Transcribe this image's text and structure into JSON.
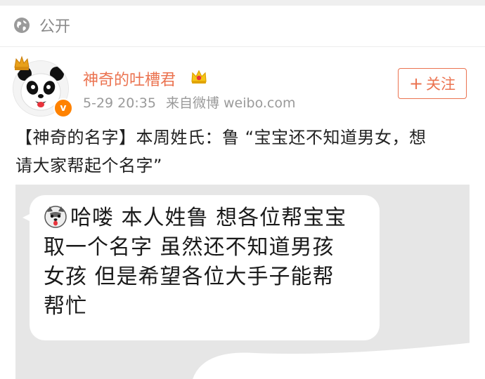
{
  "visibility": {
    "label": "公开",
    "icon": "globe-icon"
  },
  "post": {
    "username": "神奇的吐槽君",
    "date": "5-29 20:35",
    "source": "来自微博 weibo.com",
    "follow_label": "关注",
    "text_line1": "【神奇的名字】本周姓氏：鲁 “宝宝还不知道男女，想",
    "text_line2": "请大家帮起个名字”"
  },
  "image": {
    "bubble_line1": "哈喽 本人姓鲁 想各位帮宝宝",
    "bubble_line2": "取一个名字 虽然还不知道男孩",
    "bubble_line3": "女孩 但是希望各位大手子能帮",
    "bubble_line4": "帮忙"
  },
  "colors": {
    "accent": "#eb7350",
    "meta": "#9a9a9a",
    "vip_badge": "#ff8200"
  }
}
